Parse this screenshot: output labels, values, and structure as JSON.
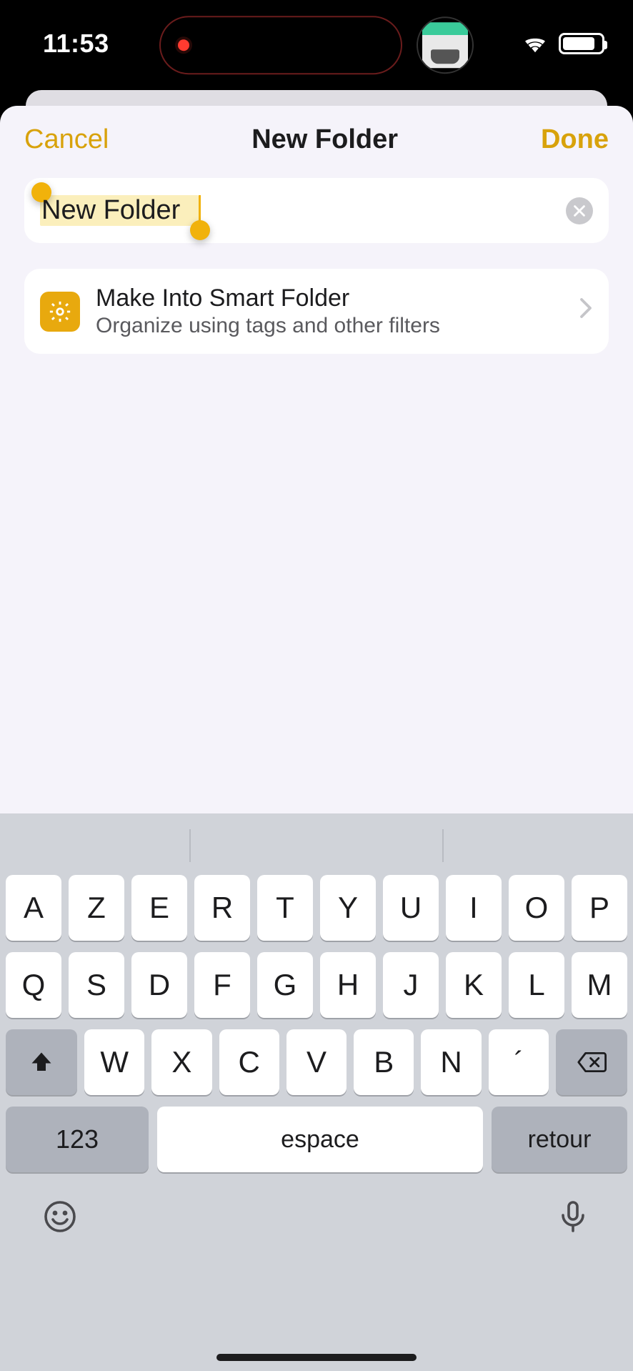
{
  "status": {
    "time": "11:53"
  },
  "nav": {
    "cancel": "Cancel",
    "title": "New Folder",
    "done": "Done"
  },
  "input": {
    "value": "New Folder"
  },
  "smart": {
    "title": "Make Into Smart Folder",
    "subtitle": "Organize using tags and other filters"
  },
  "keyboard": {
    "row1": [
      "A",
      "Z",
      "E",
      "R",
      "T",
      "Y",
      "U",
      "I",
      "O",
      "P"
    ],
    "row2": [
      "Q",
      "S",
      "D",
      "F",
      "G",
      "H",
      "J",
      "K",
      "L",
      "M"
    ],
    "row3": [
      "W",
      "X",
      "C",
      "V",
      "B",
      "N",
      "´"
    ],
    "numbers": "123",
    "space": "espace",
    "return": "retour"
  }
}
